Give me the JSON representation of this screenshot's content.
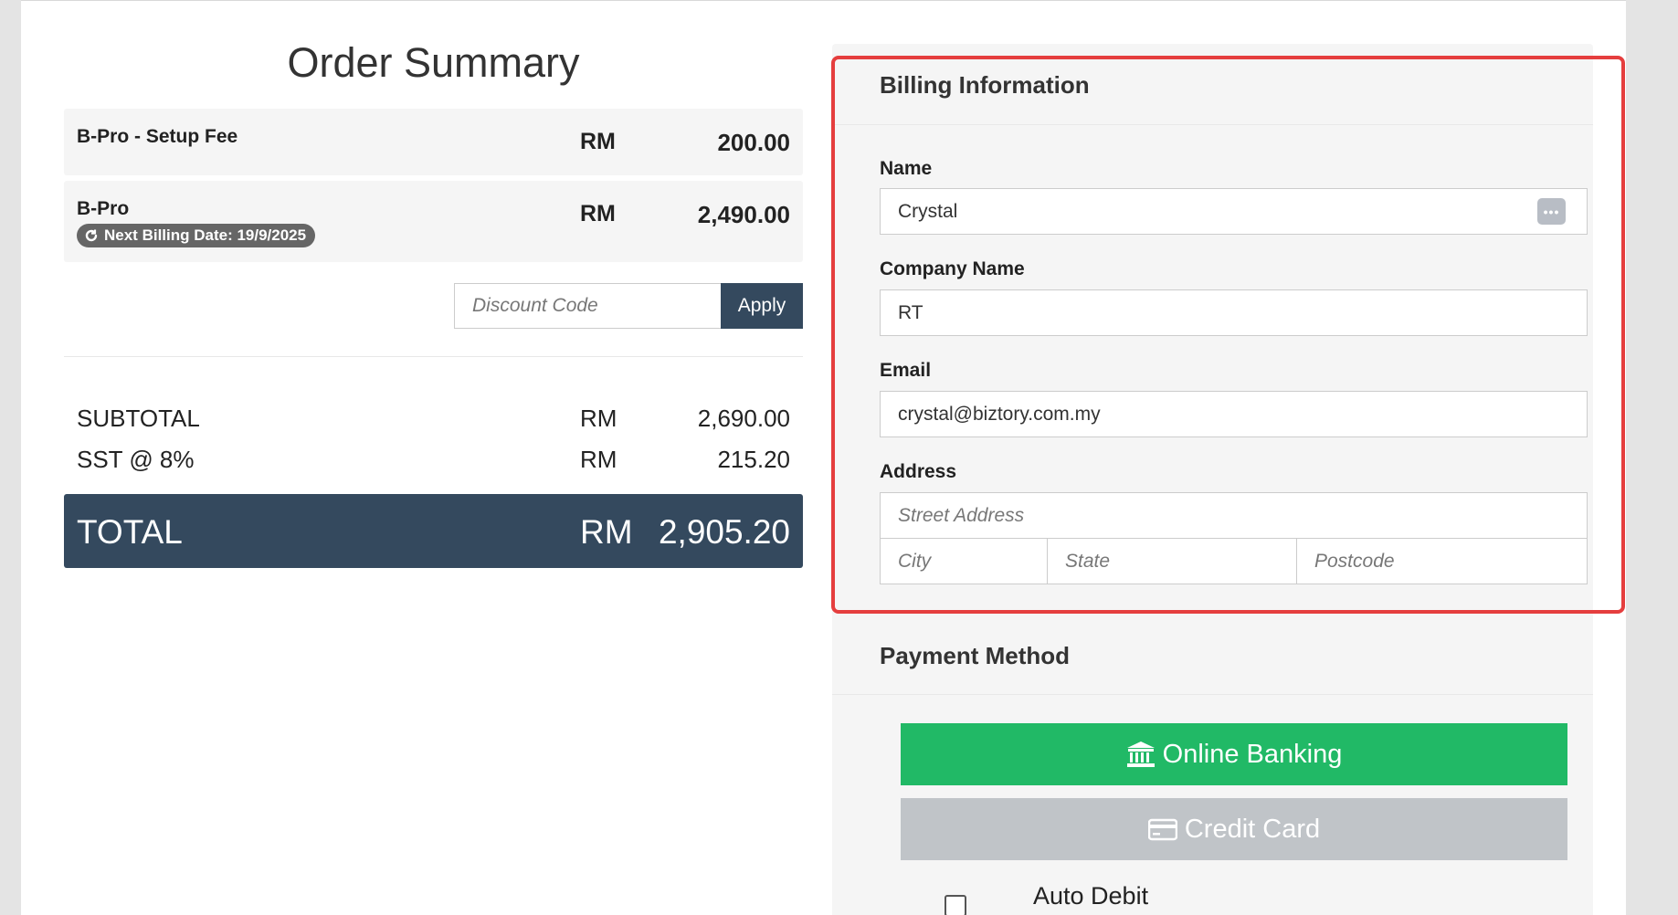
{
  "order_summary": {
    "title": "Order Summary",
    "items": [
      {
        "name": "B-Pro - Setup Fee",
        "currency": "RM",
        "amount": "200.00"
      },
      {
        "name": "B-Pro",
        "currency": "RM",
        "amount": "2,490.00",
        "badge": "Next Billing Date: 19/9/2025"
      }
    ],
    "discount": {
      "placeholder": "Discount Code",
      "apply_label": "Apply"
    },
    "subtotal": {
      "label": "SUBTOTAL",
      "currency": "RM",
      "amount": "2,690.00"
    },
    "tax": {
      "label": "SST @ 8%",
      "currency": "RM",
      "amount": "215.20"
    },
    "total": {
      "label": "TOTAL",
      "currency": "RM",
      "amount": "2,905.20"
    }
  },
  "billing": {
    "heading": "Billing Information",
    "name": {
      "label": "Name",
      "value": "Crystal"
    },
    "company": {
      "label": "Company Name",
      "value": "RT"
    },
    "email": {
      "label": "Email",
      "value": "crystal@biztory.com.my"
    },
    "address": {
      "label": "Address",
      "street_placeholder": "Street Address",
      "city_placeholder": "City",
      "state_placeholder": "State",
      "postcode_placeholder": "Postcode"
    },
    "highlight_color": "#e53e3e"
  },
  "payment": {
    "heading": "Payment Method",
    "online_banking_label": "Online Banking",
    "credit_card_label": "Credit Card",
    "auto_debit_label": "Auto Debit",
    "online_banking_color": "#21b966",
    "credit_card_color": "#c0c4c8"
  },
  "icons": {
    "badge": "refresh-icon",
    "online_banking": "bank-icon",
    "credit_card": "credit-card-icon",
    "autofill": "autofill-icon"
  },
  "colors": {
    "primary_dark": "#34495e",
    "background": "#e4e4e4"
  }
}
